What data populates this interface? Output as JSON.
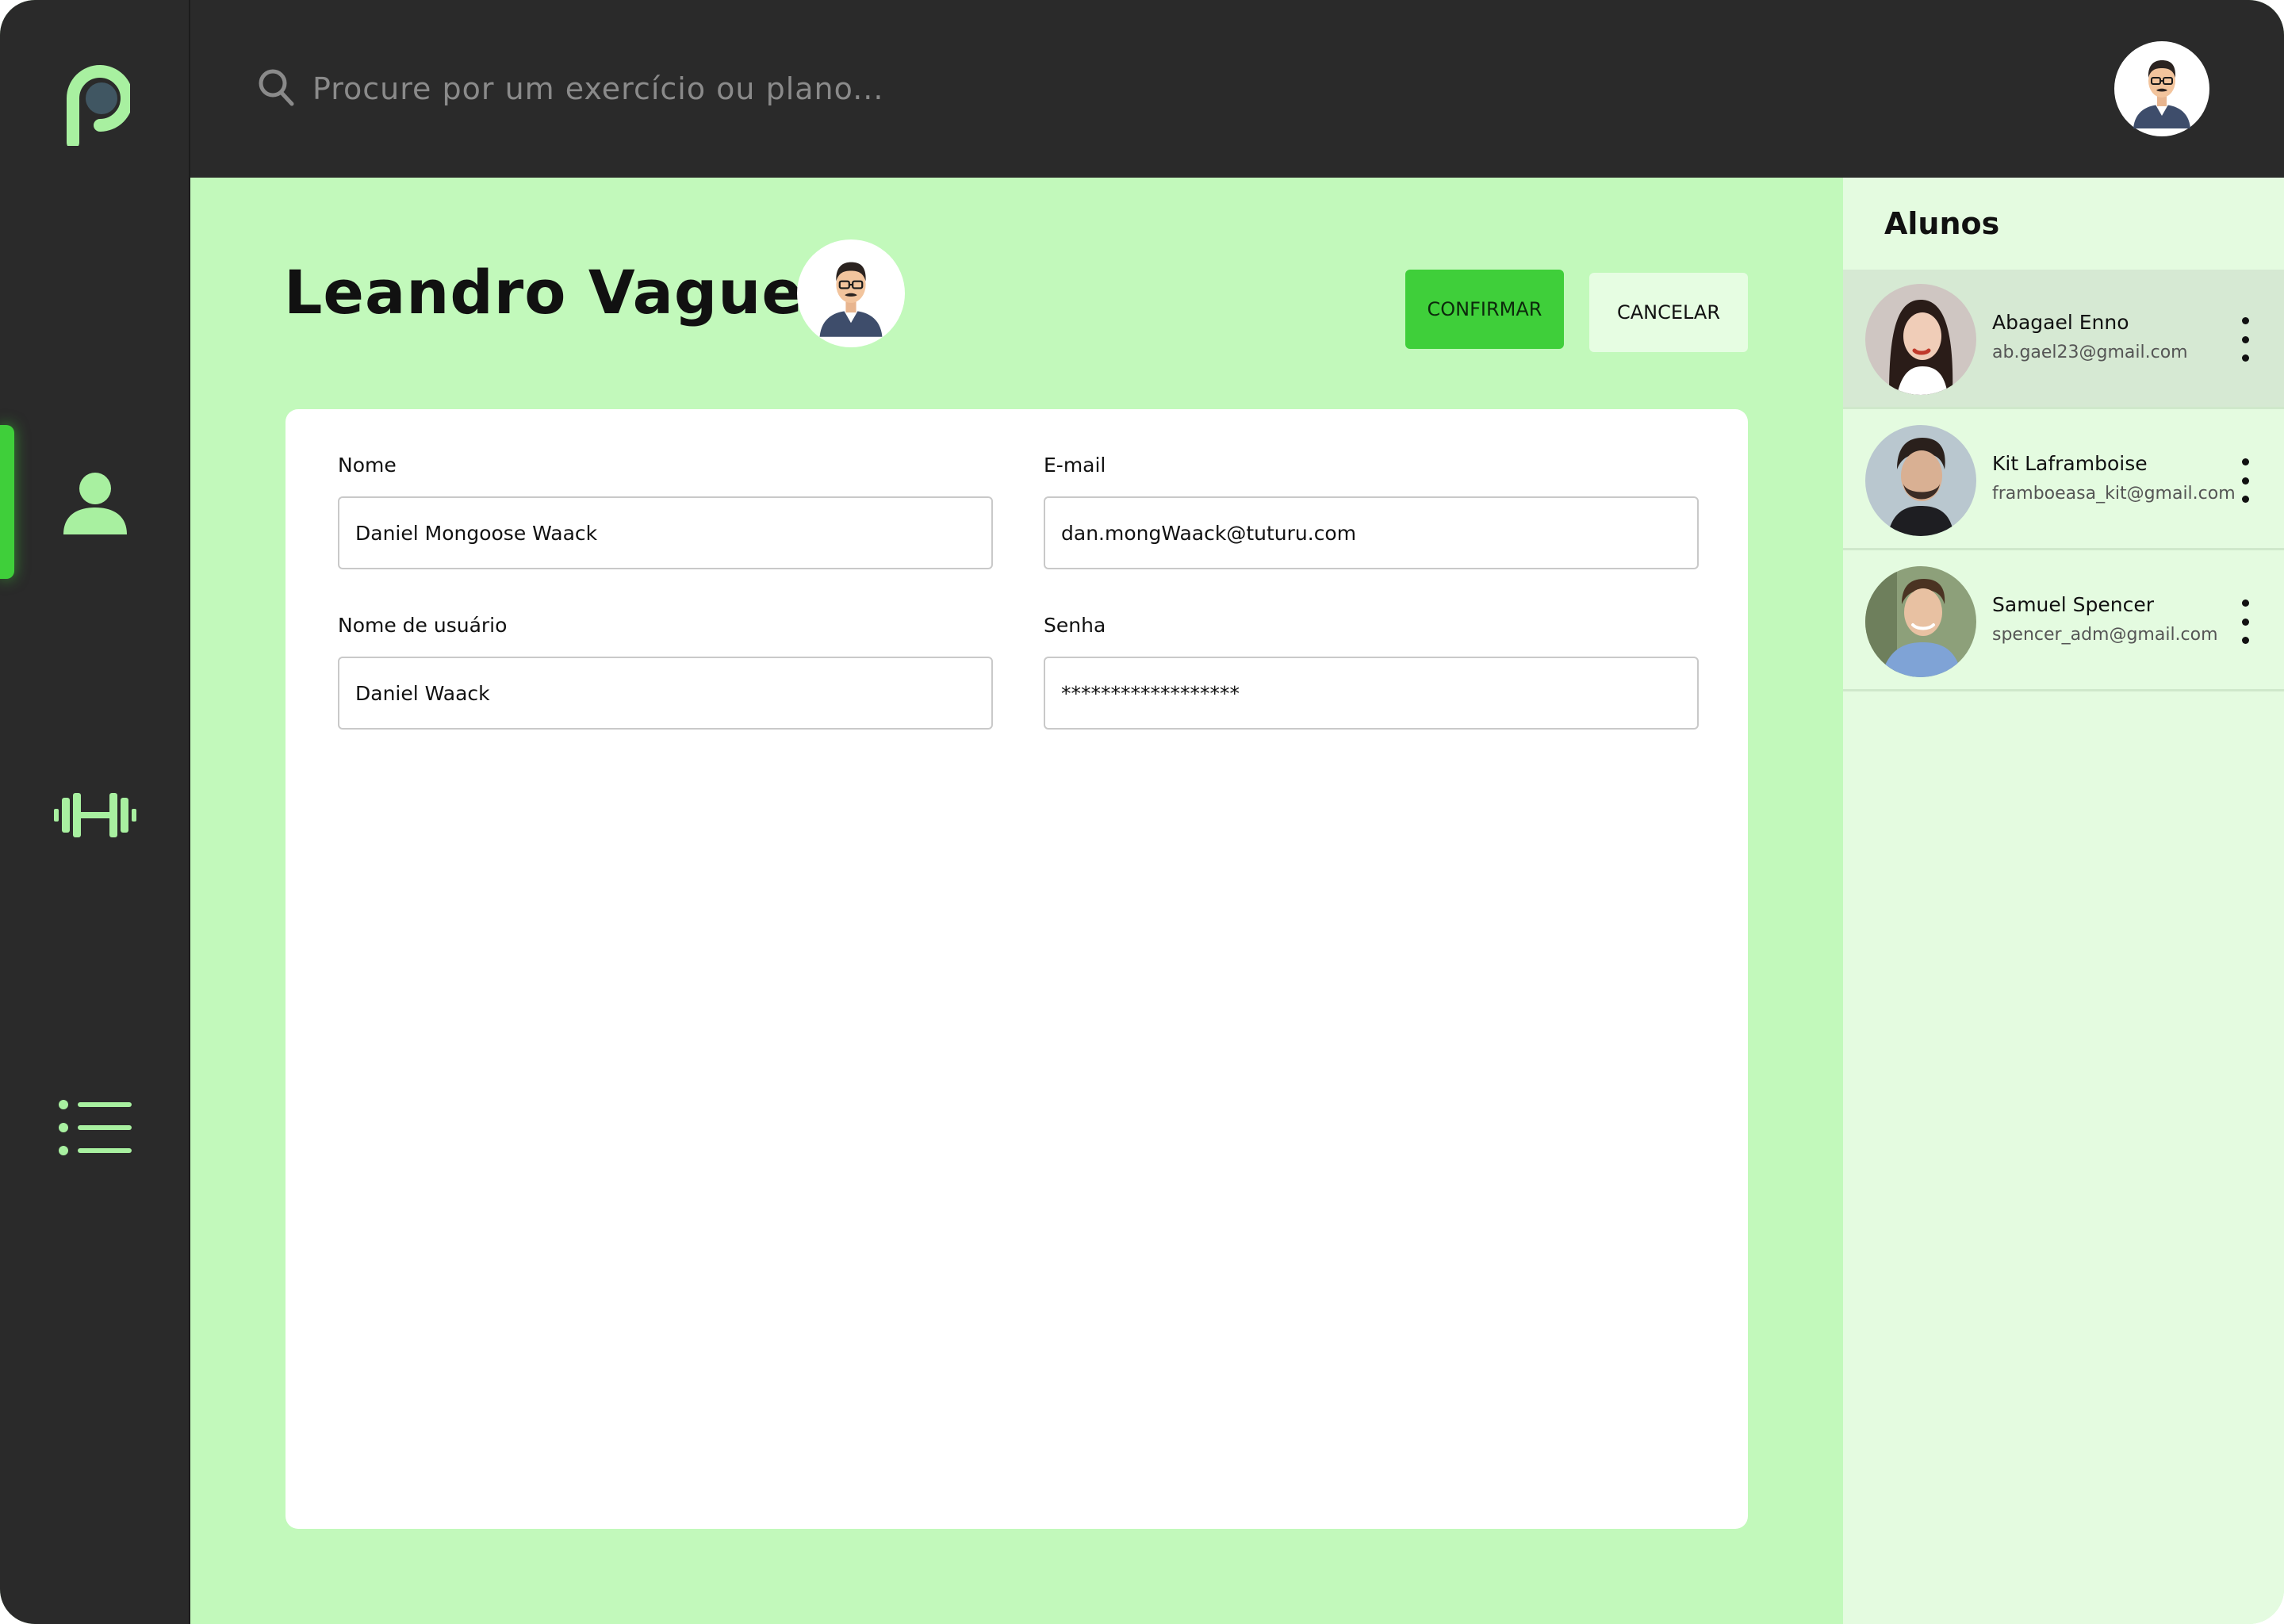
{
  "brand": {
    "logo_icon": "p-logo-icon"
  },
  "nav": {
    "items": [
      {
        "icon": "user-icon",
        "active": true
      },
      {
        "icon": "dumbbell-icon",
        "active": false
      },
      {
        "icon": "list-icon",
        "active": false
      }
    ]
  },
  "search": {
    "placeholder": "Procure por um exercício ou plano..."
  },
  "profile": {
    "name": "Leandro Vaguetti",
    "confirm_label": "CONFIRMAR",
    "cancel_label": "CANCELAR"
  },
  "form": {
    "name_label": "Nome",
    "name_value": "Daniel Mongoose Waack",
    "email_label": "E-mail",
    "email_value": "dan.mongWaack@tuturu.com",
    "username_label": "Nome de usuário",
    "username_value": "Daniel Waack",
    "password_label": "Senha",
    "password_value": "******************"
  },
  "students": {
    "title": "Alunos",
    "items": [
      {
        "name": "Abagael Enno",
        "email": "ab.gael23@gmail.com",
        "selected": true
      },
      {
        "name": "Kit Laframboise",
        "email": "framboeasa_kit@gmail.com",
        "selected": false
      },
      {
        "name": "Samuel Spencer",
        "email": "spencer_adm@gmail.com",
        "selected": false
      }
    ]
  },
  "colors": {
    "accent": "#3fcf3a",
    "nav_icon": "#a8f0a0",
    "dark": "#2a2a2a",
    "main_bg": "#c2f9bb",
    "panel_bg": "#e4fbe0"
  }
}
